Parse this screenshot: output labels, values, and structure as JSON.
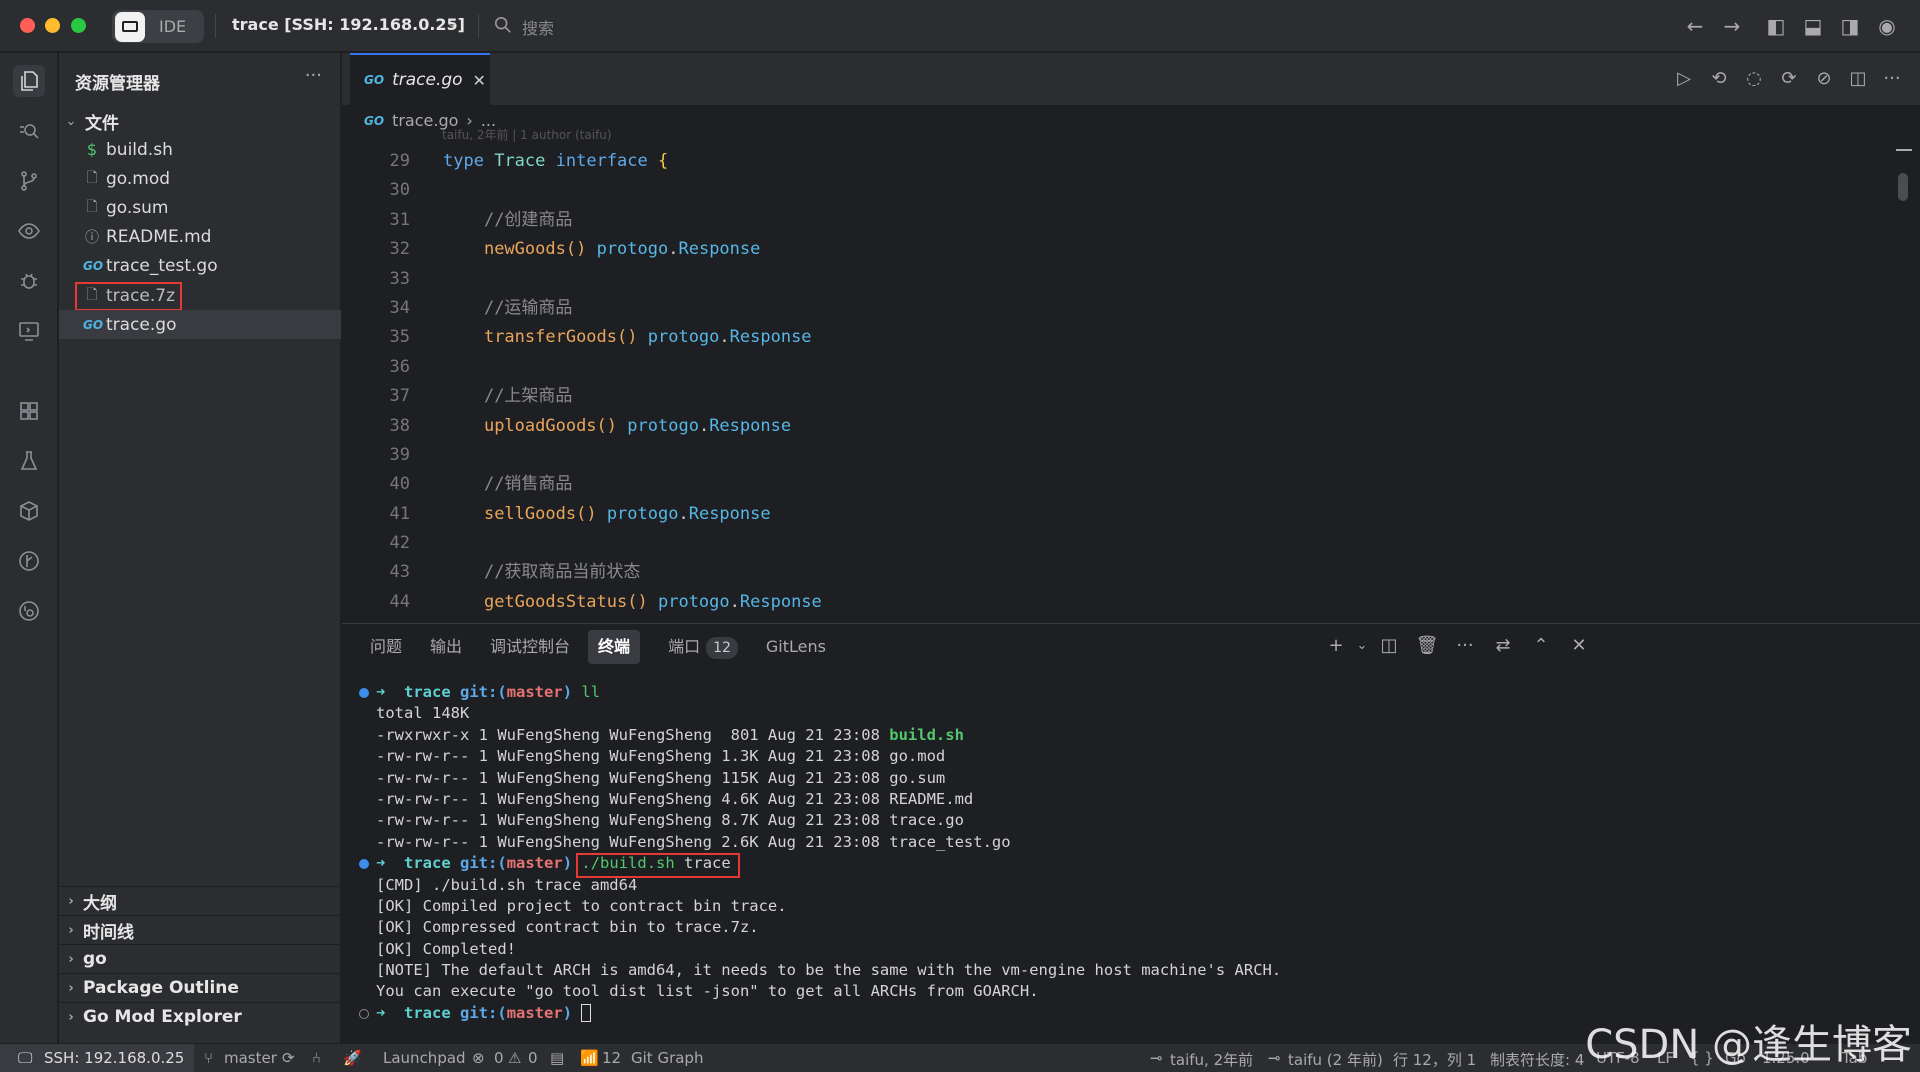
{
  "titlebar": {
    "ide_label": "IDE",
    "window_title": "trace [SSH: 192.168.0.25]",
    "search_placeholder": "搜索"
  },
  "sidebar": {
    "title": "资源管理器",
    "folder": "文件",
    "files": [
      {
        "name": "build.sh",
        "icon": "dollar-icon"
      },
      {
        "name": "go.mod",
        "icon": "file-icon"
      },
      {
        "name": "go.sum",
        "icon": "file-icon"
      },
      {
        "name": "README.md",
        "icon": "info-icon"
      },
      {
        "name": "trace_test.go",
        "icon": "go-icon"
      },
      {
        "name": "trace.7z",
        "icon": "file-icon"
      },
      {
        "name": "trace.go",
        "icon": "go-icon"
      }
    ],
    "panels": [
      "大纲",
      "时间线",
      "go",
      "Package Outline",
      "Go Mod Explorer"
    ]
  },
  "editor": {
    "tab_label": "trace.go",
    "breadcrumb_file": "trace.go",
    "breadcrumb_more": "...",
    "blame_ghost": "taifu, 2年前 | 1 author (taifu)",
    "lines": [
      {
        "n": "29",
        "kind": "type",
        "kw1": "type",
        "name": "Trace",
        "kw2": "interface",
        "brace": "{"
      },
      {
        "n": "30",
        "kind": "blank"
      },
      {
        "n": "31",
        "kind": "comment",
        "text": "//创建商品"
      },
      {
        "n": "32",
        "kind": "method",
        "fn": "newGoods",
        "paren": "()",
        "pkg": "protogo",
        "type": "Response"
      },
      {
        "n": "33",
        "kind": "blank"
      },
      {
        "n": "34",
        "kind": "comment",
        "text": "//运输商品"
      },
      {
        "n": "35",
        "kind": "method",
        "fn": "transferGoods",
        "paren": "()",
        "pkg": "protogo",
        "type": "Response"
      },
      {
        "n": "36",
        "kind": "blank"
      },
      {
        "n": "37",
        "kind": "comment",
        "text": "//上架商品"
      },
      {
        "n": "38",
        "kind": "method",
        "fn": "uploadGoods",
        "paren": "()",
        "pkg": "protogo",
        "type": "Response"
      },
      {
        "n": "39",
        "kind": "blank"
      },
      {
        "n": "40",
        "kind": "comment",
        "text": "//销售商品"
      },
      {
        "n": "41",
        "kind": "method",
        "fn": "sellGoods",
        "paren": "()",
        "pkg": "protogo",
        "type": "Response"
      },
      {
        "n": "42",
        "kind": "blank"
      },
      {
        "n": "43",
        "kind": "comment",
        "text": "//获取商品当前状态"
      },
      {
        "n": "44",
        "kind": "method",
        "fn": "getGoodsStatus",
        "paren": "()",
        "pkg": "protogo",
        "type": "Response"
      }
    ]
  },
  "panel": {
    "tabs": [
      "问题",
      "输出",
      "调试控制台",
      "终端",
      "端口",
      "GitLens"
    ],
    "ports_badge": "12",
    "terminal": [
      {
        "kind": "prompt",
        "dot": "filled",
        "dir": "trace",
        "git": "git:(",
        "branch": "master",
        "close": ")",
        "cmd": "ll",
        "cmd_style": "green"
      },
      {
        "kind": "text",
        "text": "total 148K"
      },
      {
        "kind": "ls",
        "text": "-rwxrwxr-x 1 WuFengSheng WuFengSheng  801 Aug 21 23:08 ",
        "file": "build.sh",
        "exec": true
      },
      {
        "kind": "ls",
        "text": "-rw-rw-r-- 1 WuFengSheng WuFengSheng 1.3K Aug 21 23:08 ",
        "file": "go.mod"
      },
      {
        "kind": "ls",
        "text": "-rw-rw-r-- 1 WuFengSheng WuFengSheng 115K Aug 21 23:08 ",
        "file": "go.sum"
      },
      {
        "kind": "ls",
        "text": "-rw-rw-r-- 1 WuFengSheng WuFengSheng 4.6K Aug 21 23:08 ",
        "file": "README.md"
      },
      {
        "kind": "ls",
        "text": "-rw-rw-r-- 1 WuFengSheng WuFengSheng 8.7K Aug 21 23:08 ",
        "file": "trace.go"
      },
      {
        "kind": "ls",
        "text": "-rw-rw-r-- 1 WuFengSheng WuFengSheng 2.6K Aug 21 23:08 ",
        "file": "trace_test.go"
      },
      {
        "kind": "prompt",
        "dot": "filled",
        "dir": "trace",
        "git": "git:(",
        "branch": "master",
        "close": ")",
        "cmd": "./build.sh",
        "cmd_arg": " trace",
        "cmd_style": "green"
      },
      {
        "kind": "text",
        "text": "[CMD] ./build.sh trace amd64"
      },
      {
        "kind": "text",
        "text": "[OK] Compiled project to contract bin trace."
      },
      {
        "kind": "text",
        "text": "[OK] Compressed contract bin to trace.7z."
      },
      {
        "kind": "text",
        "text": "[OK] Completed!"
      },
      {
        "kind": "text",
        "text": "[NOTE] The default ARCH is amd64, it needs to be the same with the vm-engine host machine's ARCH."
      },
      {
        "kind": "text",
        "text": "You can execute \"go tool dist list -json\" to get all ARCHs from GOARCH."
      },
      {
        "kind": "prompt",
        "dot": "empty",
        "dir": "trace",
        "git": "git:(",
        "branch": "master",
        "close": ")",
        "cmd": "",
        "cursor": true
      }
    ]
  },
  "statusbar": {
    "ssh": "SSH: 192.168.0.25",
    "branch": "master",
    "launchpad": "Launchpad",
    "errors": "0",
    "warnings": "0",
    "ports": "12",
    "git_graph": "Git Graph",
    "blame1": "taifu, 2年前",
    "blame2": "taifu (2 年前)",
    "position": "行 12，列 1",
    "tab_size": "制表符长度: 4",
    "encoding": "UTF-8",
    "eol": "LF",
    "braces": "{ }",
    "language": "Go",
    "go_version": "1.25.0",
    "indent": "Tab"
  },
  "watermark": "CSDN @逢生博客"
}
